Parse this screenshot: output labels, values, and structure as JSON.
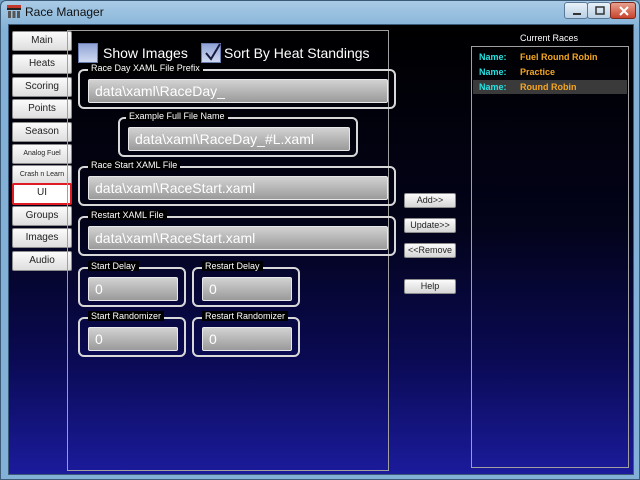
{
  "window": {
    "title": "Race Manager"
  },
  "nav": {
    "items": [
      {
        "label": "Main"
      },
      {
        "label": "Heats"
      },
      {
        "label": "Scoring"
      },
      {
        "label": "Points"
      },
      {
        "label": "Season"
      },
      {
        "label": "Analog Fuel"
      },
      {
        "label": "Crash n Learn"
      },
      {
        "label": "UI",
        "selected": true
      },
      {
        "label": "Groups"
      },
      {
        "label": "Images"
      },
      {
        "label": "Audio"
      }
    ]
  },
  "options": {
    "show_images": {
      "label": "Show Images",
      "checked": false
    },
    "sort_by_heat": {
      "label": "Sort By Heat Standings",
      "checked": true
    }
  },
  "fields": {
    "raceday_prefix": {
      "label": "Race Day XAML File Prefix",
      "value": "data\\xaml\\RaceDay_"
    },
    "example_name": {
      "label": "Example Full File Name",
      "value": "data\\xaml\\RaceDay_#L.xaml"
    },
    "race_start": {
      "label": "Race Start XAML File",
      "value": "data\\xaml\\RaceStart.xaml"
    },
    "restart": {
      "label": "Restart XAML File",
      "value": "data\\xaml\\RaceStart.xaml"
    },
    "start_delay": {
      "label": "Start Delay",
      "value": "0"
    },
    "restart_delay": {
      "label": "Restart Delay",
      "value": "0"
    },
    "start_randomizer": {
      "label": "Start Randomizer",
      "value": "0"
    },
    "restart_randomizer": {
      "label": "Restart Randomizer",
      "value": "0"
    }
  },
  "actions": {
    "add": "Add>>",
    "update": "Update>>",
    "remove": "<<Remove",
    "help": "Help"
  },
  "races": {
    "title": "Current Races",
    "name_label": "Name:",
    "items": [
      {
        "name": "Fuel Round Robin"
      },
      {
        "name": "Practice"
      },
      {
        "name": "Round Robin",
        "selected": true
      }
    ]
  },
  "colors": {
    "accent_cyan": "#27e3e3",
    "accent_orange": "#f5a623",
    "selected_nav_border": "#e01b24"
  }
}
